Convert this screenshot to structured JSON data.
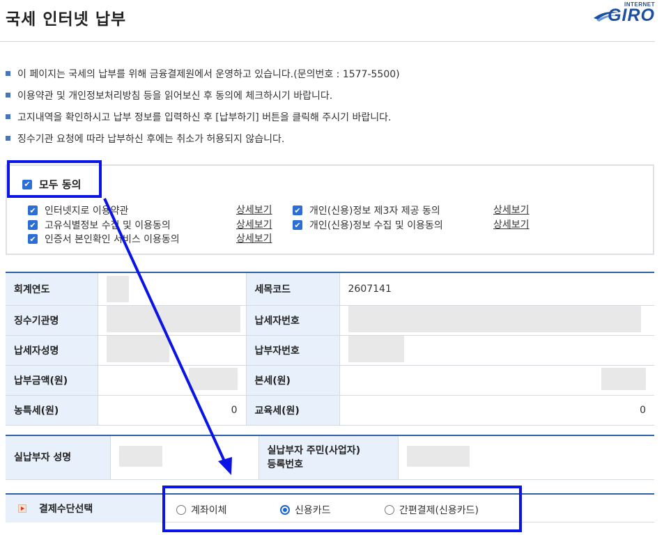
{
  "header": {
    "title": "국세 인터넷 납부",
    "logo_small": "INTERNET",
    "logo_big": "GIRO"
  },
  "notices": [
    "이 페이지는 국세의 납부를 위해 금융결제원에서 운영하고 있습니다.(문의번호 : 1577-5500)",
    "이용약관 및 개인정보처리방침 등을 읽어보신 후 동의에 체크하시기 바랍니다.",
    "고지내역을 확인하시고 납부 정보를 입력하신 후 [납부하기] 버튼을 클릭해 주시기 바랍니다.",
    "징수기관 요청에 따라 납부하신 후에는 취소가 허용되지 않습니다."
  ],
  "agreement": {
    "all_label": "모두 동의",
    "all_checked": true,
    "detail_link": "상세보기",
    "terms": [
      {
        "label": "인터넷지로 이용약관",
        "checked": true
      },
      {
        "label": "고유식별정보 수집 및 이용동의",
        "checked": true
      },
      {
        "label": "인증서 본인확인 서비스 이용동의",
        "checked": true
      },
      {
        "label": "개인(신용)정보 제3자 제공 동의",
        "checked": true
      },
      {
        "label": "개인(신용)정보 수집 및 이용동의",
        "checked": true
      }
    ]
  },
  "info_table": {
    "fiscal_year_label": "회계연도",
    "tax_code_label": "세목코드",
    "tax_code_value": "2607141",
    "agency_label": "징수기관명",
    "taxpayer_no_label": "납세자번호",
    "taxpayer_name_label": "납세자성명",
    "payer_no_label": "납부자번호",
    "amount_label": "납부금액(원)",
    "principal_label": "본세(원)",
    "rural_tax_label": "농특세(원)",
    "rural_tax_value": "0",
    "edu_tax_label": "교육세(원)",
    "edu_tax_value": "0"
  },
  "payer_table": {
    "name_label": "실납부자 성명",
    "id_label_line1": "실납부자 주민(사업자)",
    "id_label_line2": "등록번호"
  },
  "payment_method": {
    "label": "결제수단선택",
    "options": [
      {
        "label": "계좌이체",
        "selected": false
      },
      {
        "label": "신용카드",
        "selected": true
      },
      {
        "label": "간편결제(신용카드)",
        "selected": false
      }
    ]
  },
  "colors": {
    "accent": "#2e5fa8",
    "label_bg": "#e7f0fb",
    "checkbox": "#2b6fd6",
    "annotation": "#0a14e6"
  }
}
